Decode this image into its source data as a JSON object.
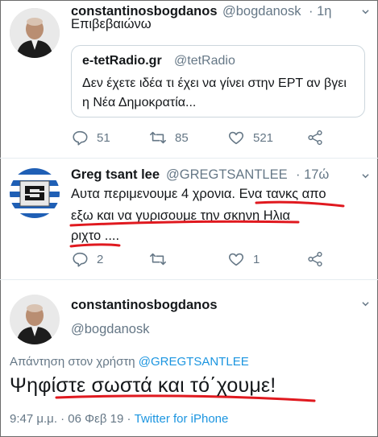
{
  "tweet1": {
    "name": "constantinosbogdanos",
    "handle": "@bogdanosk",
    "time": "· 1η",
    "text": "Επιβεβαιώνω",
    "quote": {
      "name": "e-tetRadio.gr",
      "handle": "@tetRadio",
      "text": "Δεν έχετε ιδέα τι έχει να γίνει στην ΕΡΤ αν βγει η Νέα Δημοκρατία..."
    },
    "actions": {
      "reply_icon": "reply-icon",
      "reply_count": "51",
      "retweet_icon": "retweet-icon",
      "retweet_count": "85",
      "like_icon": "heart-icon",
      "like_count": "521",
      "share_icon": "share-icon"
    }
  },
  "tweet2": {
    "name": "Greg tsant lee",
    "handle": "@GREGTSANTLEE",
    "time": "· 17ώ",
    "line1": "Αυτα περιμενουμε 4 χρονια. Ενα τανκς απο",
    "line2": "εξω και να γυρισουμε την σκηνη Ηλια",
    "line3": "ριχτο ....",
    "actions": {
      "reply_count": "2",
      "retweet_count": "",
      "like_count": "1"
    }
  },
  "tweet3": {
    "name": "constantinosbogdanos",
    "handle": "@bogdanosk",
    "reply_prefix": "Απάντηση στον χρήστη",
    "reply_mention": "@GREGTSANTLEE",
    "text": "Ψηφίστε σωστά και τό΄χουμε!",
    "timestamp": "9:47 μ.μ. · 06 Φεβ 19 · ",
    "source": "Twitter for iPhone"
  },
  "colors": {
    "text": "#14171a",
    "secondary": "#657786",
    "link": "#1b95e0",
    "annotation_red": "#e0191f",
    "divider": "#e6ecf0"
  }
}
